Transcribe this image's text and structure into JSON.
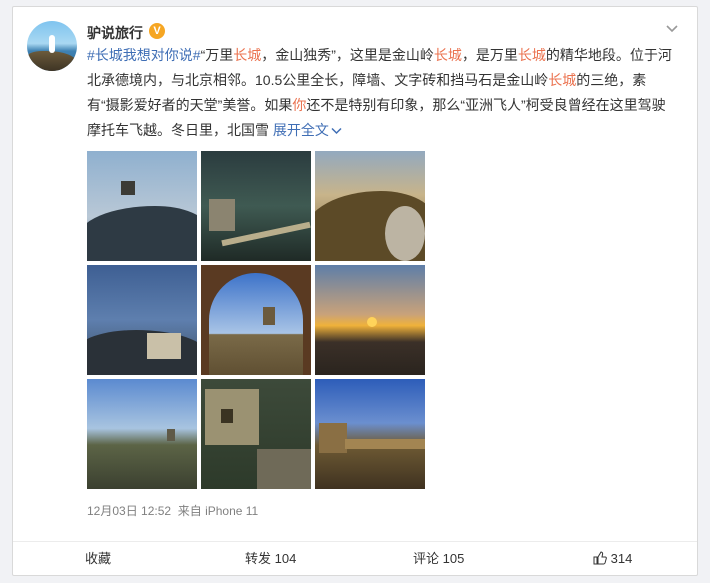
{
  "post": {
    "username": "驴说旅行",
    "verified_badge": "V",
    "more_icon": "chevron-down-icon",
    "text_segments": {
      "tag": "#长城我想对你说#",
      "s1": "“万里",
      "l1": "长城",
      "s2": "，金山独秀”，这里是金山岭",
      "l2": "长城",
      "s3": "，是万里",
      "l3": "长城",
      "s4": "的精华地段。位于河北承德境内，与北京相邻。10.5公里全长，障墙、文字砖和挡马石是金山岭",
      "l4": "长城",
      "s5": "的三绝，素有“摄影爱好者的天堂”美誉。如果",
      "l5": "你",
      "s6": "还不是特别有印象，那么“亚洲飞人”柯受良曾经在这里驾驶摩托车飞越。冬日里，北国雪",
      "expand": "展开全文"
    },
    "meta": {
      "date": "12月03日 12:52",
      "source": "来自 iPhone 11"
    }
  },
  "actions": {
    "favorite": "收藏",
    "repost": "转发 104",
    "comment": "评论 105",
    "like": "314"
  },
  "colors": {
    "link": "#eb7350",
    "tag": "#3f6eb5",
    "meta": "#808080",
    "verified": "#f6a623"
  }
}
